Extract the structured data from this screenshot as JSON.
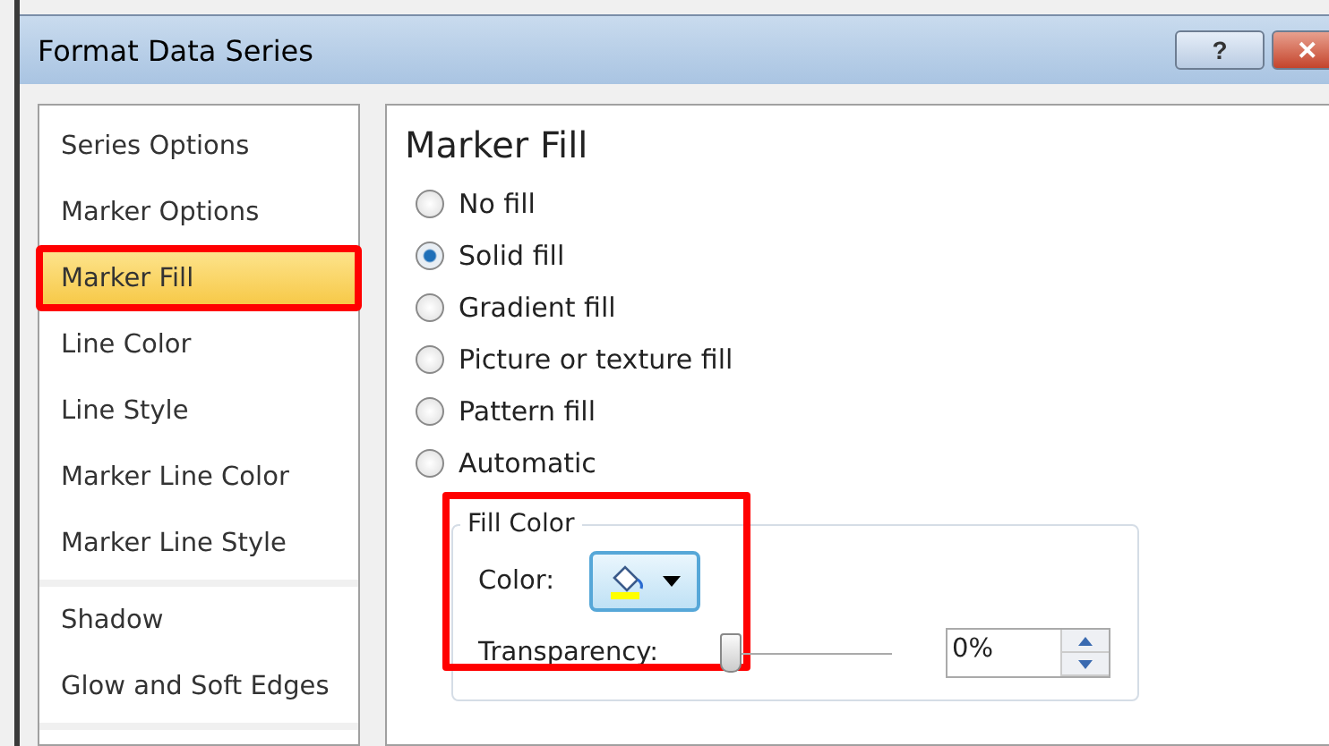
{
  "window": {
    "title": "Format Data Series",
    "buttons": [
      {
        "kind": "help",
        "label": "?"
      },
      {
        "kind": "close",
        "label": "✕"
      }
    ]
  },
  "nav": {
    "groups": [
      [
        {
          "label": "Series Options",
          "selected": false,
          "highlight": false
        },
        {
          "label": "Marker Options",
          "selected": false,
          "highlight": false
        },
        {
          "label": "Marker Fill",
          "selected": true,
          "highlight": true
        },
        {
          "label": "Line Color",
          "selected": false,
          "highlight": false
        },
        {
          "label": "Line Style",
          "selected": false,
          "highlight": false
        },
        {
          "label": "Marker Line Color",
          "selected": false,
          "highlight": false
        },
        {
          "label": "Marker Line Style",
          "selected": false,
          "highlight": false
        }
      ],
      [
        {
          "label": "Shadow",
          "selected": false,
          "highlight": false
        },
        {
          "label": "Glow and Soft Edges",
          "selected": false,
          "highlight": false
        }
      ]
    ]
  },
  "panel": {
    "heading": "Marker Fill",
    "options": [
      {
        "label": "No fill",
        "selected": false
      },
      {
        "label": "Solid fill",
        "selected": true
      },
      {
        "label": "Gradient fill",
        "selected": false
      },
      {
        "label": "Picture or texture fill",
        "selected": false
      },
      {
        "label": "Pattern fill",
        "selected": false
      },
      {
        "label": "Automatic",
        "selected": false
      }
    ],
    "fill_color": {
      "legend": "Fill Color",
      "highlight": true,
      "color_label": "Color:",
      "color": "#ffff00",
      "transparency_label": "Transparency:",
      "transparency": {
        "level": 0,
        "value": "0%"
      }
    }
  }
}
